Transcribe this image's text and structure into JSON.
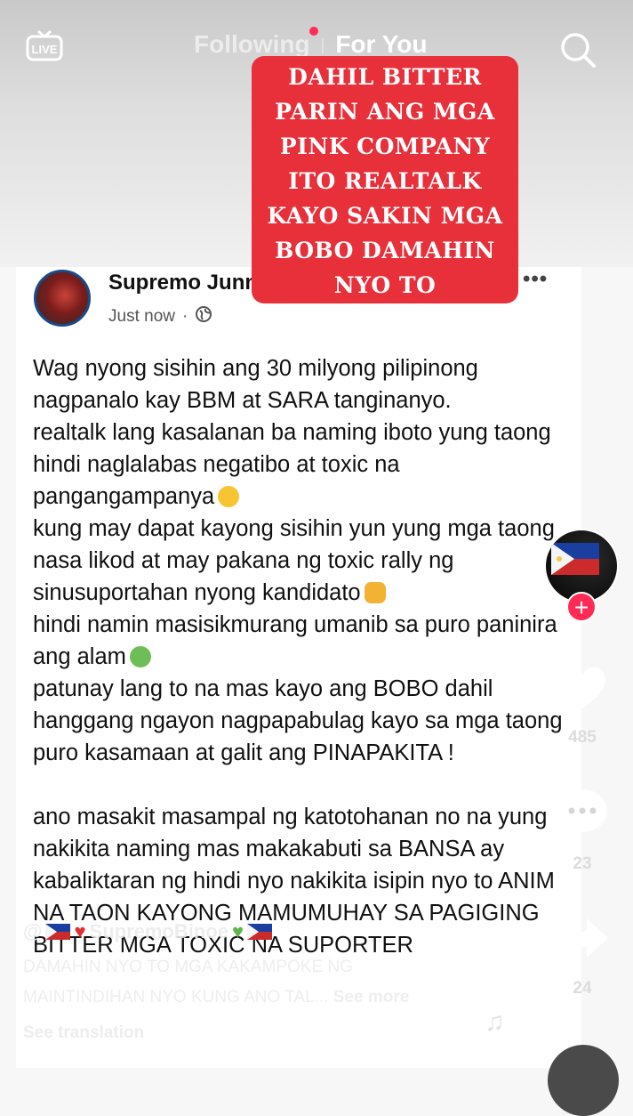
{
  "header": {
    "tab_following": "Following",
    "tab_separator": "|",
    "tab_for_you": "For You",
    "live_label": "LIVE"
  },
  "overlay_text": {
    "lines": [
      "DAHIL BITTER",
      "PARIN ANG MGA",
      "PINK COMPANY",
      "ITO REALTALK",
      "KAYO SAKIN MGA",
      "BOBO DAMAHIN",
      "NYO TO"
    ],
    "background_color": "#e8303a"
  },
  "post": {
    "author": "Supremo Junn",
    "time": "Just now",
    "separator": "·",
    "visibility_icon": "globe-icon",
    "more_label": "•••",
    "paragraphs": [
      "Wag nyong sisihin ang 30 milyong pilipinong nagpanalo kay BBM at SARA tanginanyo.",
      "realtalk lang kasalanan ba naming iboto yung taong hindi naglalabas negatibo at toxic na pangangampanya",
      "kung may dapat kayong sisihin yun yung mga taong nasa likod at may pakana ng toxic rally ng sinusuportahan nyong kandidato",
      "hindi namin masisikmurang umanib sa puro paninira ang alam",
      "patunay lang to na mas kayo ang BOBO dahil hanggang ngayon nagpapabulag kayo sa mga taong puro kasamaan at galit ang PINAPAKITA !",
      "ano masakit masampal ng katotohanan no na yung nakikita naming mas makakabuti sa BANSA ay kabaliktaran ng hindi nyo nakikita isipin nyo to ANIM NA TAON KAYONG MAMUMUHAY SA PAGIGING BITTER MGA TOXIC NA SUPORTER"
    ]
  },
  "sidebar": {
    "likes": "485",
    "comments": "23",
    "shares": "24"
  },
  "caption": {
    "username": "SupremoBinoe",
    "line1": "DAMAHIN NYO TO MGA KAKAMPOKE NG",
    "line2": "MAINTINDIHAN NYO KUNG ANO TAL...",
    "see_more": "See more",
    "see_translation": "See translation"
  },
  "colors": {
    "accent_red": "#fe2c55",
    "text_dark": "#111111"
  }
}
